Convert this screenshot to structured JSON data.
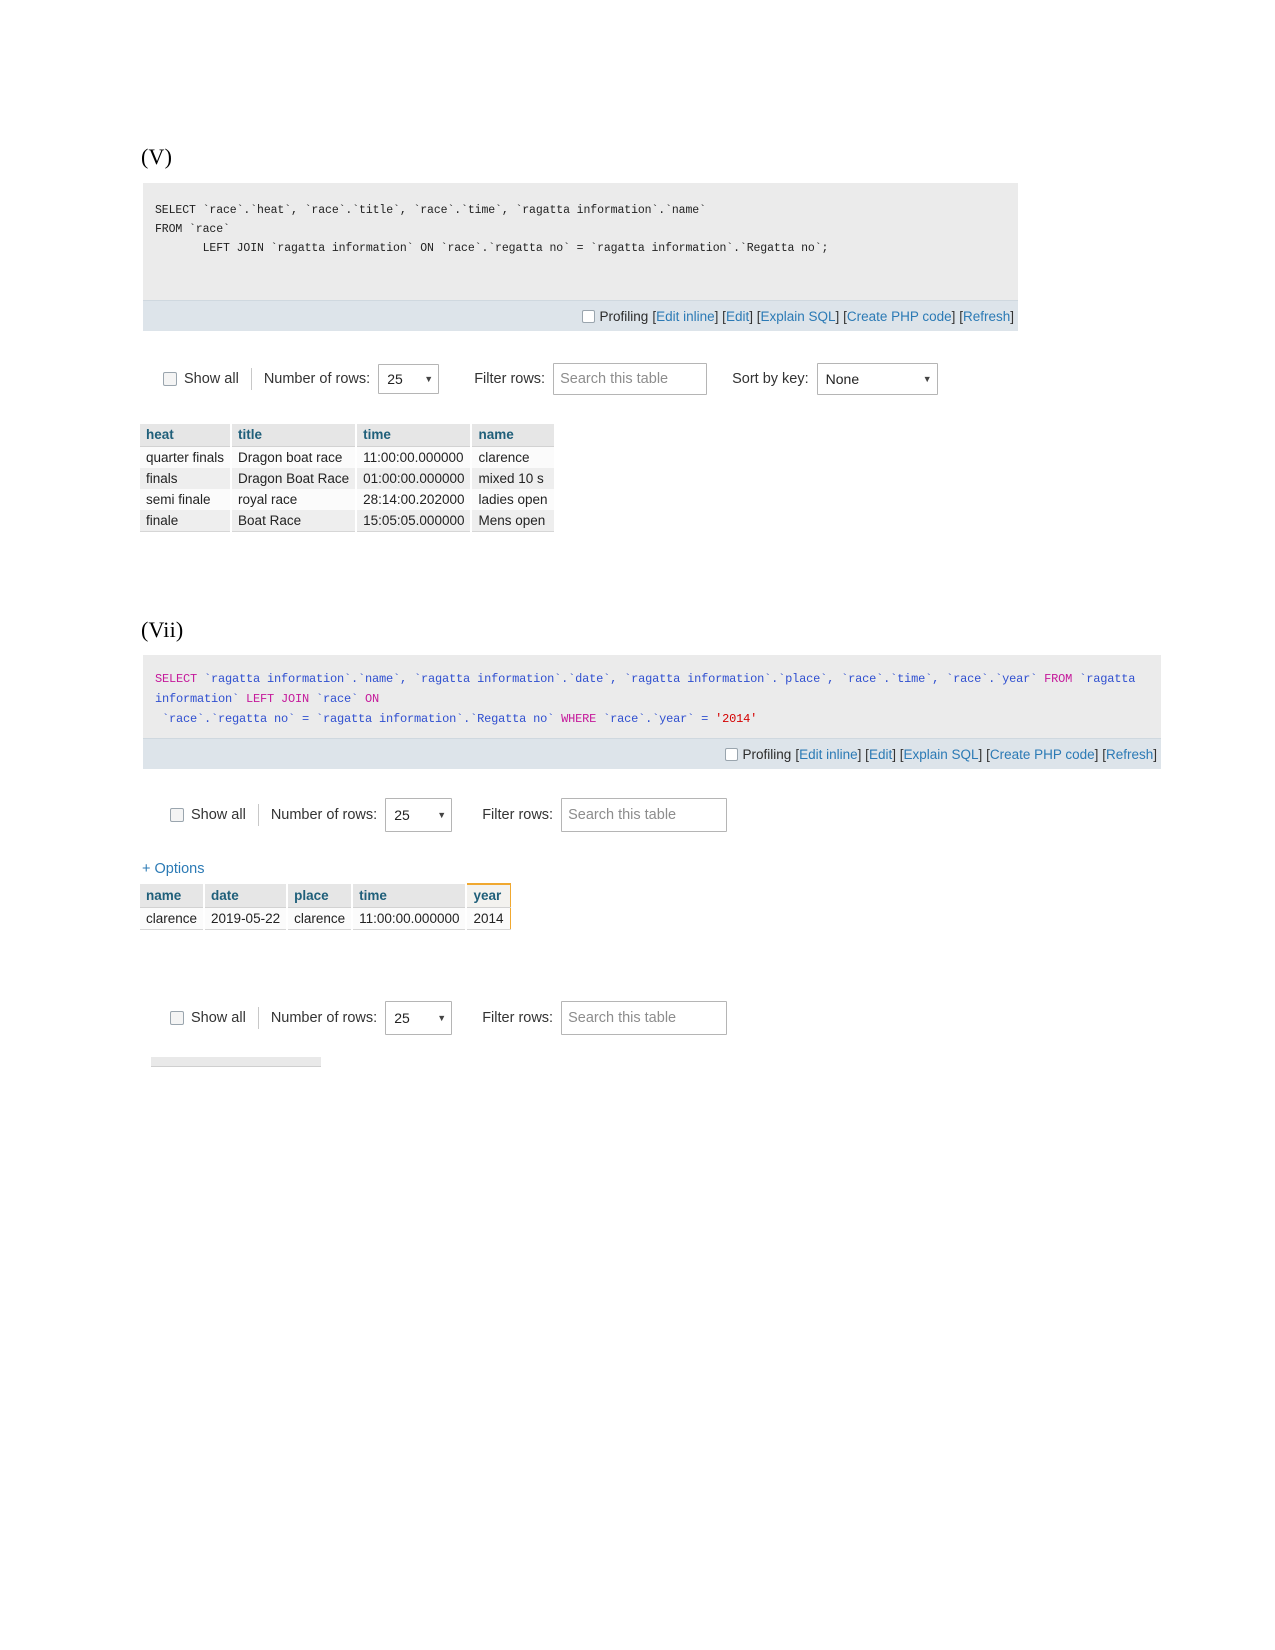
{
  "sections": [
    {
      "label": "(V)",
      "sql_lines": [
        "SELECT `race`.`heat`, `race`.`title`, `race`.`time`, `ragatta information`.`name`",
        "FROM `race`",
        "       LEFT JOIN `ragatta information` ON `race`.`regatta no` = `ragatta information`.`Regatta no`;"
      ],
      "toolbar": {
        "profiling_label": "Profiling",
        "links": [
          "Edit inline",
          "Edit",
          "Explain SQL",
          "Create PHP code",
          "Refresh"
        ]
      },
      "controls": {
        "show_all_label": "Show all",
        "number_of_rows_label": "Number of rows:",
        "rows_value": "25",
        "filter_rows_label": "Filter rows:",
        "filter_placeholder": "Search this table",
        "sort_by_key_label": "Sort by key:",
        "sort_value": "None",
        "caret": "▼"
      },
      "table": {
        "columns": [
          "heat",
          "title",
          "time",
          "name"
        ],
        "rows": [
          [
            "quarter finals",
            "Dragon boat race",
            "11:00:00.000000",
            "clarence"
          ],
          [
            "finals",
            "Dragon Boat Race",
            "01:00:00.000000",
            "mixed 10 s"
          ],
          [
            "semi finale",
            "royal race",
            "28:14:00.202000",
            "ladies open"
          ],
          [
            "finale",
            "Boat Race",
            "15:05:05.000000",
            "Mens open"
          ]
        ]
      }
    },
    {
      "label": "(Vii)",
      "sql_tokens": [
        [
          {
            "t": "SELECT",
            "c": "kw"
          },
          {
            "t": " `ragatta information`.`name`, `ragatta information`.`date`, `ragatta information`.`place`, `race`.`time`, `race`.`year` ",
            "c": "id"
          },
          {
            "t": "FROM",
            "c": "kw"
          },
          {
            "t": " `ragatta information` ",
            "c": "id"
          },
          {
            "t": "LEFT JOIN",
            "c": "kw"
          },
          {
            "t": " `race` ",
            "c": "id"
          },
          {
            "t": "ON",
            "c": "kw"
          }
        ],
        [
          {
            "t": " `race`.`regatta no` = `ragatta information`.`Regatta no` ",
            "c": "id"
          },
          {
            "t": "WHERE",
            "c": "kw"
          },
          {
            "t": " `race`.`year` = ",
            "c": "id"
          },
          {
            "t": "'2014'",
            "c": "str"
          }
        ]
      ],
      "toolbar": {
        "profiling_label": "Profiling",
        "links": [
          "Edit inline",
          "Edit",
          "Explain SQL",
          "Create PHP code",
          "Refresh"
        ]
      },
      "controls": {
        "show_all_label": "Show all",
        "number_of_rows_label": "Number of rows:",
        "rows_value": "25",
        "filter_rows_label": "Filter rows:",
        "filter_placeholder": "Search this table",
        "caret": "▼"
      },
      "options_link": "+ Options",
      "table": {
        "columns": [
          "name",
          "date",
          "place",
          "time",
          "year"
        ],
        "highlight_column": "year",
        "rows": [
          [
            "clarence",
            "2019-05-22",
            "clarence",
            "11:00:00.000000",
            "2014"
          ]
        ]
      },
      "controls2": {
        "show_all_label": "Show all",
        "number_of_rows_label": "Number of rows:",
        "rows_value": "25",
        "filter_rows_label": "Filter rows:",
        "filter_placeholder": "Search this table",
        "caret": "▼"
      }
    }
  ],
  "colors": {
    "panel_bg": "#ebebeb",
    "toolbar_bg": "#dde4ea",
    "link": "#2b7ab5",
    "header_text": "#1f5f7a",
    "keyword": "#c5199b",
    "identifier": "#2f4fd0",
    "string": "#d40000",
    "highlight_border": "#f0a830"
  }
}
